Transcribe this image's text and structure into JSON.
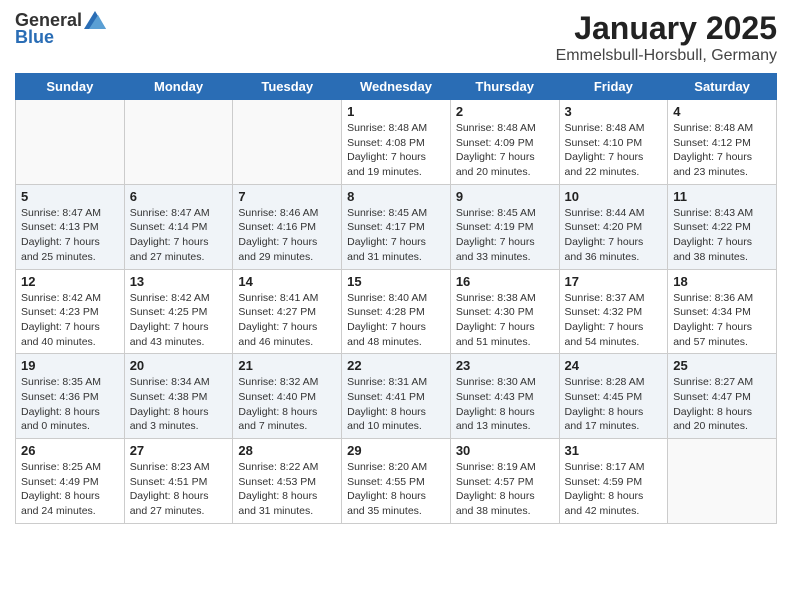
{
  "logo": {
    "text_general": "General",
    "text_blue": "Blue"
  },
  "title": "January 2025",
  "subtitle": "Emmelsbull-Horsbull, Germany",
  "days_of_week": [
    "Sunday",
    "Monday",
    "Tuesday",
    "Wednesday",
    "Thursday",
    "Friday",
    "Saturday"
  ],
  "weeks": [
    [
      {
        "day": "",
        "empty": true
      },
      {
        "day": "",
        "empty": true
      },
      {
        "day": "",
        "empty": true
      },
      {
        "day": "1",
        "sunrise": "Sunrise: 8:48 AM",
        "sunset": "Sunset: 4:08 PM",
        "daylight": "Daylight: 7 hours and 19 minutes."
      },
      {
        "day": "2",
        "sunrise": "Sunrise: 8:48 AM",
        "sunset": "Sunset: 4:09 PM",
        "daylight": "Daylight: 7 hours and 20 minutes."
      },
      {
        "day": "3",
        "sunrise": "Sunrise: 8:48 AM",
        "sunset": "Sunset: 4:10 PM",
        "daylight": "Daylight: 7 hours and 22 minutes."
      },
      {
        "day": "4",
        "sunrise": "Sunrise: 8:48 AM",
        "sunset": "Sunset: 4:12 PM",
        "daylight": "Daylight: 7 hours and 23 minutes."
      }
    ],
    [
      {
        "day": "5",
        "sunrise": "Sunrise: 8:47 AM",
        "sunset": "Sunset: 4:13 PM",
        "daylight": "Daylight: 7 hours and 25 minutes."
      },
      {
        "day": "6",
        "sunrise": "Sunrise: 8:47 AM",
        "sunset": "Sunset: 4:14 PM",
        "daylight": "Daylight: 7 hours and 27 minutes."
      },
      {
        "day": "7",
        "sunrise": "Sunrise: 8:46 AM",
        "sunset": "Sunset: 4:16 PM",
        "daylight": "Daylight: 7 hours and 29 minutes."
      },
      {
        "day": "8",
        "sunrise": "Sunrise: 8:45 AM",
        "sunset": "Sunset: 4:17 PM",
        "daylight": "Daylight: 7 hours and 31 minutes."
      },
      {
        "day": "9",
        "sunrise": "Sunrise: 8:45 AM",
        "sunset": "Sunset: 4:19 PM",
        "daylight": "Daylight: 7 hours and 33 minutes."
      },
      {
        "day": "10",
        "sunrise": "Sunrise: 8:44 AM",
        "sunset": "Sunset: 4:20 PM",
        "daylight": "Daylight: 7 hours and 36 minutes."
      },
      {
        "day": "11",
        "sunrise": "Sunrise: 8:43 AM",
        "sunset": "Sunset: 4:22 PM",
        "daylight": "Daylight: 7 hours and 38 minutes."
      }
    ],
    [
      {
        "day": "12",
        "sunrise": "Sunrise: 8:42 AM",
        "sunset": "Sunset: 4:23 PM",
        "daylight": "Daylight: 7 hours and 40 minutes."
      },
      {
        "day": "13",
        "sunrise": "Sunrise: 8:42 AM",
        "sunset": "Sunset: 4:25 PM",
        "daylight": "Daylight: 7 hours and 43 minutes."
      },
      {
        "day": "14",
        "sunrise": "Sunrise: 8:41 AM",
        "sunset": "Sunset: 4:27 PM",
        "daylight": "Daylight: 7 hours and 46 minutes."
      },
      {
        "day": "15",
        "sunrise": "Sunrise: 8:40 AM",
        "sunset": "Sunset: 4:28 PM",
        "daylight": "Daylight: 7 hours and 48 minutes."
      },
      {
        "day": "16",
        "sunrise": "Sunrise: 8:38 AM",
        "sunset": "Sunset: 4:30 PM",
        "daylight": "Daylight: 7 hours and 51 minutes."
      },
      {
        "day": "17",
        "sunrise": "Sunrise: 8:37 AM",
        "sunset": "Sunset: 4:32 PM",
        "daylight": "Daylight: 7 hours and 54 minutes."
      },
      {
        "day": "18",
        "sunrise": "Sunrise: 8:36 AM",
        "sunset": "Sunset: 4:34 PM",
        "daylight": "Daylight: 7 hours and 57 minutes."
      }
    ],
    [
      {
        "day": "19",
        "sunrise": "Sunrise: 8:35 AM",
        "sunset": "Sunset: 4:36 PM",
        "daylight": "Daylight: 8 hours and 0 minutes."
      },
      {
        "day": "20",
        "sunrise": "Sunrise: 8:34 AM",
        "sunset": "Sunset: 4:38 PM",
        "daylight": "Daylight: 8 hours and 3 minutes."
      },
      {
        "day": "21",
        "sunrise": "Sunrise: 8:32 AM",
        "sunset": "Sunset: 4:40 PM",
        "daylight": "Daylight: 8 hours and 7 minutes."
      },
      {
        "day": "22",
        "sunrise": "Sunrise: 8:31 AM",
        "sunset": "Sunset: 4:41 PM",
        "daylight": "Daylight: 8 hours and 10 minutes."
      },
      {
        "day": "23",
        "sunrise": "Sunrise: 8:30 AM",
        "sunset": "Sunset: 4:43 PM",
        "daylight": "Daylight: 8 hours and 13 minutes."
      },
      {
        "day": "24",
        "sunrise": "Sunrise: 8:28 AM",
        "sunset": "Sunset: 4:45 PM",
        "daylight": "Daylight: 8 hours and 17 minutes."
      },
      {
        "day": "25",
        "sunrise": "Sunrise: 8:27 AM",
        "sunset": "Sunset: 4:47 PM",
        "daylight": "Daylight: 8 hours and 20 minutes."
      }
    ],
    [
      {
        "day": "26",
        "sunrise": "Sunrise: 8:25 AM",
        "sunset": "Sunset: 4:49 PM",
        "daylight": "Daylight: 8 hours and 24 minutes."
      },
      {
        "day": "27",
        "sunrise": "Sunrise: 8:23 AM",
        "sunset": "Sunset: 4:51 PM",
        "daylight": "Daylight: 8 hours and 27 minutes."
      },
      {
        "day": "28",
        "sunrise": "Sunrise: 8:22 AM",
        "sunset": "Sunset: 4:53 PM",
        "daylight": "Daylight: 8 hours and 31 minutes."
      },
      {
        "day": "29",
        "sunrise": "Sunrise: 8:20 AM",
        "sunset": "Sunset: 4:55 PM",
        "daylight": "Daylight: 8 hours and 35 minutes."
      },
      {
        "day": "30",
        "sunrise": "Sunrise: 8:19 AM",
        "sunset": "Sunset: 4:57 PM",
        "daylight": "Daylight: 8 hours and 38 minutes."
      },
      {
        "day": "31",
        "sunrise": "Sunrise: 8:17 AM",
        "sunset": "Sunset: 4:59 PM",
        "daylight": "Daylight: 8 hours and 42 minutes."
      },
      {
        "day": "",
        "empty": true
      }
    ]
  ]
}
